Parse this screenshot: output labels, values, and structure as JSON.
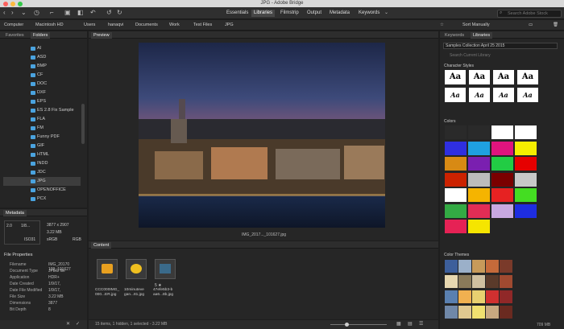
{
  "window": {
    "title": "JPG - Adobe Bridge"
  },
  "workspaces": [
    "Essentials",
    "Libraries",
    "Filmstrip",
    "Output",
    "Metadata",
    "Keywords"
  ],
  "search": {
    "placeholder": "Search Adobe Stock"
  },
  "breadcrumbs": [
    "Computer",
    "Macintosh HD",
    "Users",
    "hanaqvi",
    "Documents",
    "Work",
    "Test Files",
    "JPG"
  ],
  "sort": {
    "label": "Sort Manually"
  },
  "left": {
    "tabs": [
      "Favorites",
      "Folders"
    ],
    "folders": [
      "AI",
      "ASD",
      "BMP",
      "CF",
      "DOC",
      "DXF",
      "EPS",
      "ES 2.8 Fix Sample",
      "FLA",
      "FM",
      "Funny PDF",
      "GIF",
      "HTML",
      "INDD",
      "JDC",
      "JPG",
      "OPENOFFICE",
      "PCX"
    ]
  },
  "metadata": {
    "tab": "Metadata",
    "quick": [
      "2.0",
      "1/8...",
      "3877 x 2907",
      "3.22 MB",
      "ISO31",
      "sRGB",
      "RGB"
    ],
    "section": "File Properties",
    "rows": [
      [
        "Filename",
        "IMG_20170 109_101627"
      ],
      [
        "Document Type",
        "JPEG file"
      ],
      [
        "Application",
        "HDR+"
      ],
      [
        "Date Created",
        "1/9/17,"
      ],
      [
        "Date File Modified",
        "1/9/17,"
      ],
      [
        "File Size",
        "3.22 MB"
      ],
      [
        "Dimensions",
        "3877"
      ],
      [
        "Bit Depth",
        "8"
      ]
    ]
  },
  "preview": {
    "tab": "Preview",
    "caption": "IMG_2017..._101627.jpg"
  },
  "content": {
    "tab": "Content",
    "items": [
      {
        "label": "CCC000IMG_ 000...ER.jpg"
      },
      {
        "label": "10minuteve gan...81.jpg"
      },
      {
        "label": "47efe5b3-b aa6...8b.jpg",
        "rating": "5 ★"
      }
    ],
    "status": "15 items, 1 hidden, 1 selected - 3.22 MB"
  },
  "right": {
    "tabs": [
      "Keywords",
      "Libraries"
    ],
    "library": "Samples Collection April 25 2015",
    "search_placeholder": "Search Current Library",
    "sections": [
      "Character Styles",
      "Colors",
      "Color Themes"
    ],
    "style_glyphs": [
      "Aa",
      "Aa",
      "Aa",
      "Aa",
      "Aa",
      "Aa",
      "Aa",
      "Aa"
    ],
    "footer_size": "709 MB",
    "colors": [
      "#2a2a2a",
      "#2a2a2a",
      "#ffffff",
      "#ffffff",
      "#2f2fe0",
      "#1fa0e0",
      "#e0147e",
      "#f5ee00",
      "#d88a14",
      "#7a1fb0",
      "#22cc44",
      "#e60000",
      "#cc2200",
      "#bcbcbc",
      "#7a0000",
      "#c8c8c8",
      "#ffffff",
      "#f5b400",
      "#e62222",
      "#44dd22",
      "#33aa44",
      "#e22d55",
      "#c8a8e0",
      "#1e2de0",
      "#e62255",
      "#f5e500"
    ],
    "themes": [
      [
        "#3d5f9b",
        "#9bb0c9",
        "#c79a5a",
        "#c56a3a",
        "#7a3a2a"
      ],
      [
        "#e8d8b0",
        "#8a7a5a",
        "#d0c0a0",
        "#5a3a2a",
        "#a04a30"
      ],
      [
        "#5a80b0",
        "#f0b050",
        "#e8d070",
        "#d03030",
        "#902828"
      ],
      [
        "#7088a8",
        "#e0c890",
        "#f0e070",
        "#c8a880",
        "#6a2a20"
      ]
    ]
  }
}
